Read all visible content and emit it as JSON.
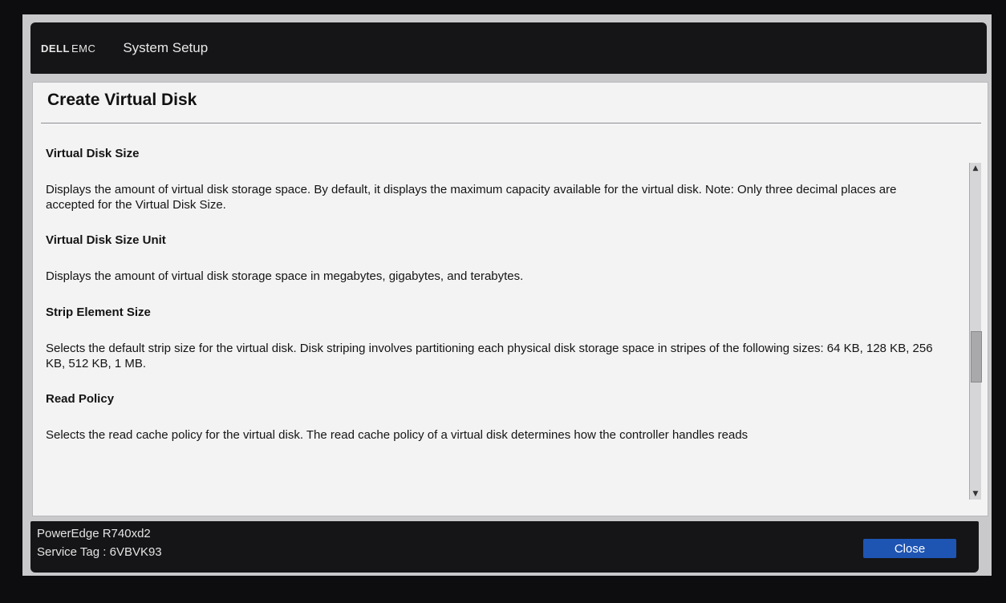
{
  "header": {
    "logo_dell": "DELL",
    "logo_emc": "EMC",
    "title": "System Setup"
  },
  "page": {
    "title": "Create Virtual Disk"
  },
  "sections": [
    {
      "heading": "Virtual Disk Size",
      "body": "Displays the amount of virtual disk storage space. By default, it displays the maximum capacity available for the virtual disk. Note: Only three decimal places are accepted for the Virtual Disk Size."
    },
    {
      "heading": "Virtual Disk Size Unit",
      "body": "Displays the amount of virtual disk storage space in megabytes, gigabytes, and terabytes."
    },
    {
      "heading": "Strip Element Size",
      "body": "Selects the default strip size for the virtual disk. Disk striping involves partitioning each physical disk storage space in stripes of the following sizes: 64 KB, 128 KB, 256 KB, 512 KB, 1 MB."
    },
    {
      "heading": "Read Policy",
      "body": "Selects the read cache policy for the virtual disk. The read cache policy of a virtual disk determines how the controller handles reads"
    }
  ],
  "footer": {
    "model": "PowerEdge R740xd2",
    "service_tag": "Service Tag : 6VBVK93",
    "close_label": "Close"
  },
  "icons": {
    "scroll_up": "arrow-up-icon",
    "scroll_down": "arrow-down-icon"
  }
}
